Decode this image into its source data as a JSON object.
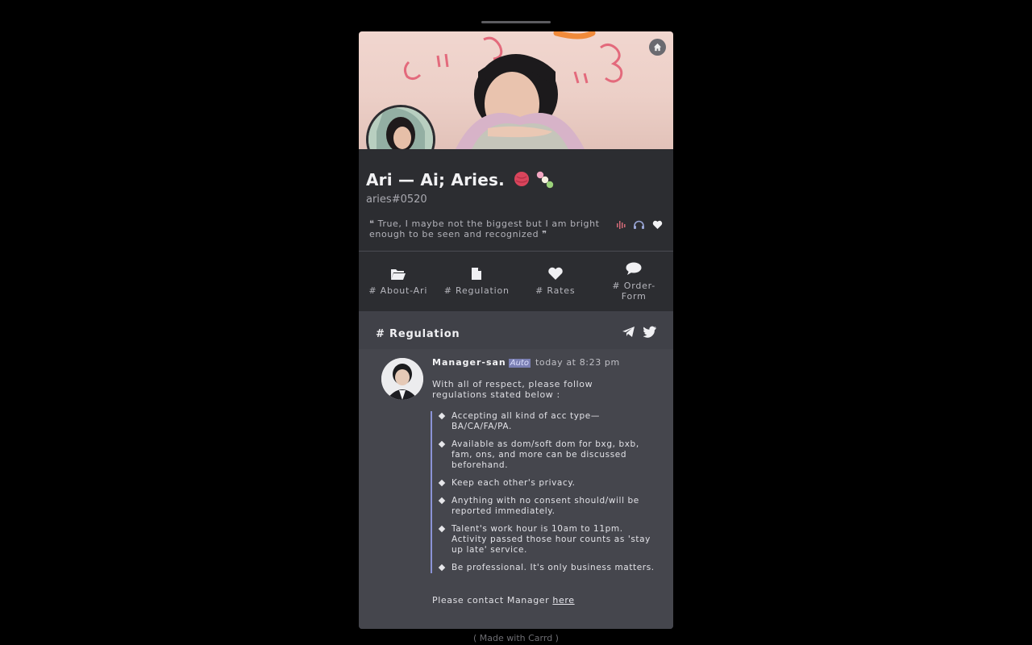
{
  "profile": {
    "name": "Ari — Ai; Aries.",
    "handle": "aries#0520",
    "quote": "❝ True, I maybe not the biggest but I am bright enough to be seen and recognized ❞"
  },
  "nav": {
    "items": [
      {
        "label": "# About-Ari",
        "icon": "folder-open-icon"
      },
      {
        "label": "# Regulation",
        "icon": "file-icon"
      },
      {
        "label": "# Rates",
        "icon": "heart-icon"
      },
      {
        "label": "# Order-Form",
        "icon": "comment-icon"
      }
    ]
  },
  "section": {
    "title": "# Regulation"
  },
  "message": {
    "author": "Manager-san",
    "badge": "Auto",
    "time": "today at 8:23 pm",
    "text": "With all of respect, please follow regulations stated below :",
    "rules": [
      "Accepting all kind of acc type—BA/CA/FA/PA.",
      "Available as dom/soft dom for bxg, bxb, fam, ons, and more can be discussed beforehand.",
      "Keep each other's privacy.",
      "Anything with no consent should/will be reported immediately.",
      "Talent's work hour is 10am to 11pm. Activity passed those hour counts as 'stay up late' service.",
      "Be professional. It's only business matters."
    ],
    "contact_prefix": "Please contact Manager",
    "contact_link": "here"
  },
  "footer": "( Made with Carrd )",
  "colors": {
    "background": "#000000",
    "card": "#2c2d31",
    "section": "#45464d",
    "accent": "#8b93d6"
  }
}
